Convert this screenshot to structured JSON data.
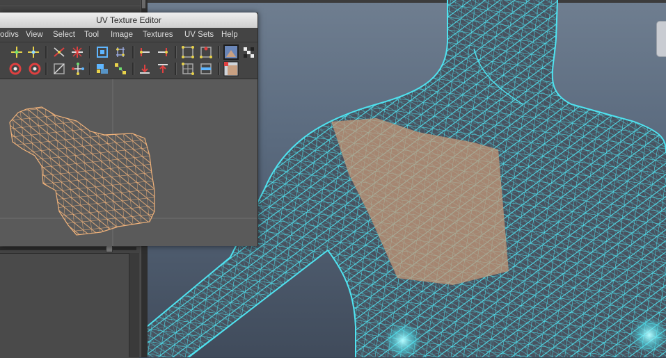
{
  "window": {
    "title": "UV Texture Editor"
  },
  "menu": {
    "items": [
      "odivs",
      "View",
      "Select",
      "Tool",
      "Image",
      "Textures",
      "UV Sets",
      "Help"
    ]
  },
  "toolbar": {
    "row1_icons": [
      "move-uv-icon",
      "move-uv-alt-icon",
      "flip-u-icon",
      "flip-v-icon",
      "rotate-icon",
      "cut-uv-icon",
      "sew-uv-icon",
      "layout-icon",
      "straighten-icon",
      "select-shell-icon",
      "select-border-icon",
      "grid-icon",
      "pin-icon",
      "texture-image-icon",
      "checker-icon"
    ],
    "row2_icons": [
      "rotate-ccw-icon",
      "rotate-cw-icon",
      "normalize-icon",
      "unfold-icon",
      "relax-icon",
      "align-icon",
      "move-down-icon",
      "move-up-icon",
      "snapshot-icon",
      "isolate-icon",
      "dim-image-icon"
    ]
  },
  "colors": {
    "viewport_wire": "#4fe3f0",
    "uv_wire": "#f0b27a",
    "selected_faces": "#c99a78"
  }
}
